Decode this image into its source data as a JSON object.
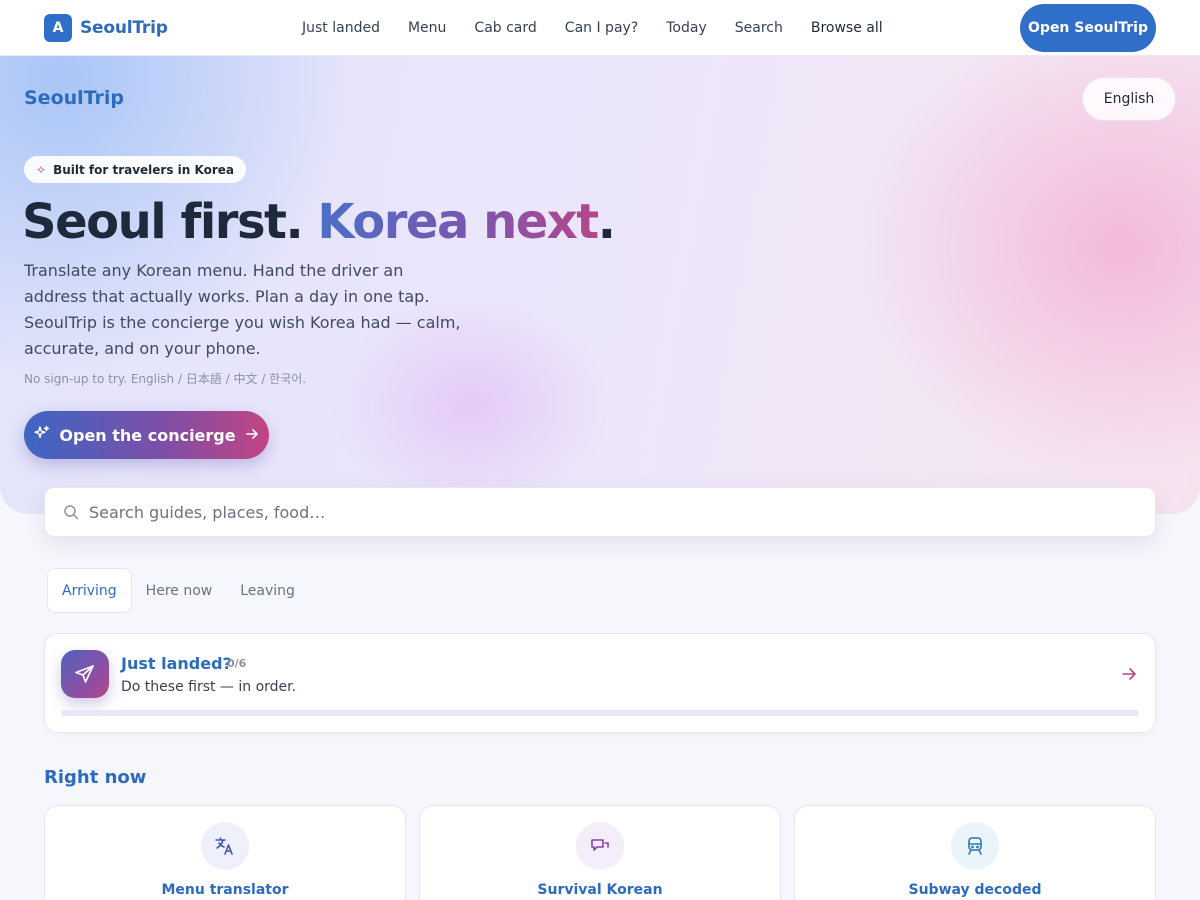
{
  "nav": {
    "brand_badge": "A",
    "brand_name": "SeoulTrip",
    "links": [
      "Just landed",
      "Menu",
      "Cab card",
      "Can I pay?",
      "Today",
      "Search",
      "Browse all"
    ],
    "cta": "Open SeoulTrip"
  },
  "hero": {
    "brand": "SeoulTrip",
    "language": "English",
    "chip": "Built for travelers in Korea",
    "title_part1": "Seoul first. ",
    "title_part2": "Korea next",
    "title_part3": ".",
    "description": "Translate any Korean menu. Hand the driver an address that actually works. Plan a day in one tap. SeoulTrip is the concierge you wish Korea had — calm, accurate, and on your phone.",
    "note": "No sign-up to try. English / 日本語 / 中文 / 한국어.",
    "cta": "Open the concierge"
  },
  "search": {
    "placeholder": "Search guides, places, food…",
    "value": ""
  },
  "tabs": [
    {
      "label": "Arriving",
      "active": true
    },
    {
      "label": "Here now",
      "active": false
    },
    {
      "label": "Leaving",
      "active": false
    }
  ],
  "checklist": {
    "title": "Just landed?",
    "count": "0/6",
    "subtitle": "Do these first — in order.",
    "progress": 0
  },
  "right_now": {
    "title": "Right now",
    "cards": [
      {
        "label": "Menu translator",
        "icon": "translate-icon"
      },
      {
        "label": "Survival Korean",
        "icon": "chat-icon"
      },
      {
        "label": "Subway decoded",
        "icon": "train-icon"
      }
    ]
  },
  "colors": {
    "brand_blue": "#2f6fca",
    "gradient_start": "#3d66c4",
    "gradient_end": "#c24482"
  }
}
